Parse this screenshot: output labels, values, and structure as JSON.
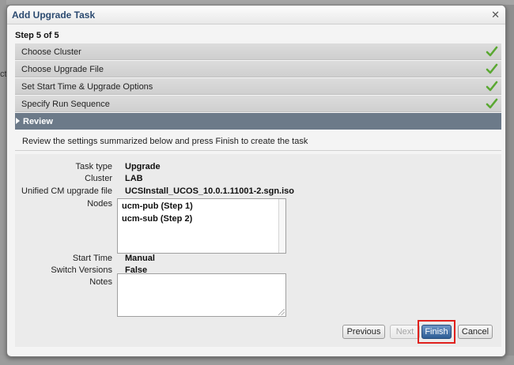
{
  "background": {
    "peek_char": "ct"
  },
  "dialog": {
    "title": "Add Upgrade Task",
    "close_glyph": "✕",
    "step_label": "Step 5 of 5"
  },
  "wizard_steps": [
    {
      "label": "Choose Cluster",
      "completed": true
    },
    {
      "label": "Choose Upgrade File",
      "completed": true
    },
    {
      "label": "Set Start Time & Upgrade Options",
      "completed": true
    },
    {
      "label": "Specify Run Sequence",
      "completed": true
    }
  ],
  "current_step": {
    "label": "Review"
  },
  "review": {
    "instruction": "Review the settings summarized below and press Finish to create the task",
    "task_type_label": "Task type",
    "task_type_value": "Upgrade",
    "cluster_label": "Cluster",
    "cluster_value": "LAB",
    "file_label": "Unified CM upgrade file",
    "file_value": "UCSInstall_UCOS_10.0.1.11001-2.sgn.iso",
    "nodes_label": "Nodes",
    "nodes": [
      "ucm-pub (Step 1)",
      "ucm-sub (Step 2)"
    ],
    "start_time_label": "Start Time",
    "start_time_value": "Manual",
    "switch_versions_label": "Switch Versions",
    "switch_versions_value": "False",
    "notes_label": "Notes",
    "notes_value": ""
  },
  "buttons": {
    "previous": "Previous",
    "next": "Next",
    "finish": "Finish",
    "cancel": "Cancel"
  },
  "colors": {
    "title_text": "#2b4a70",
    "current_step_bg": "#6c7a89",
    "check_green": "#5aa832",
    "finish_bg": "#2e5d95",
    "highlight_border": "#e0211d"
  },
  "icons": {
    "check": "checkmark-icon",
    "close": "close-icon",
    "current": "triangle-right-icon"
  }
}
